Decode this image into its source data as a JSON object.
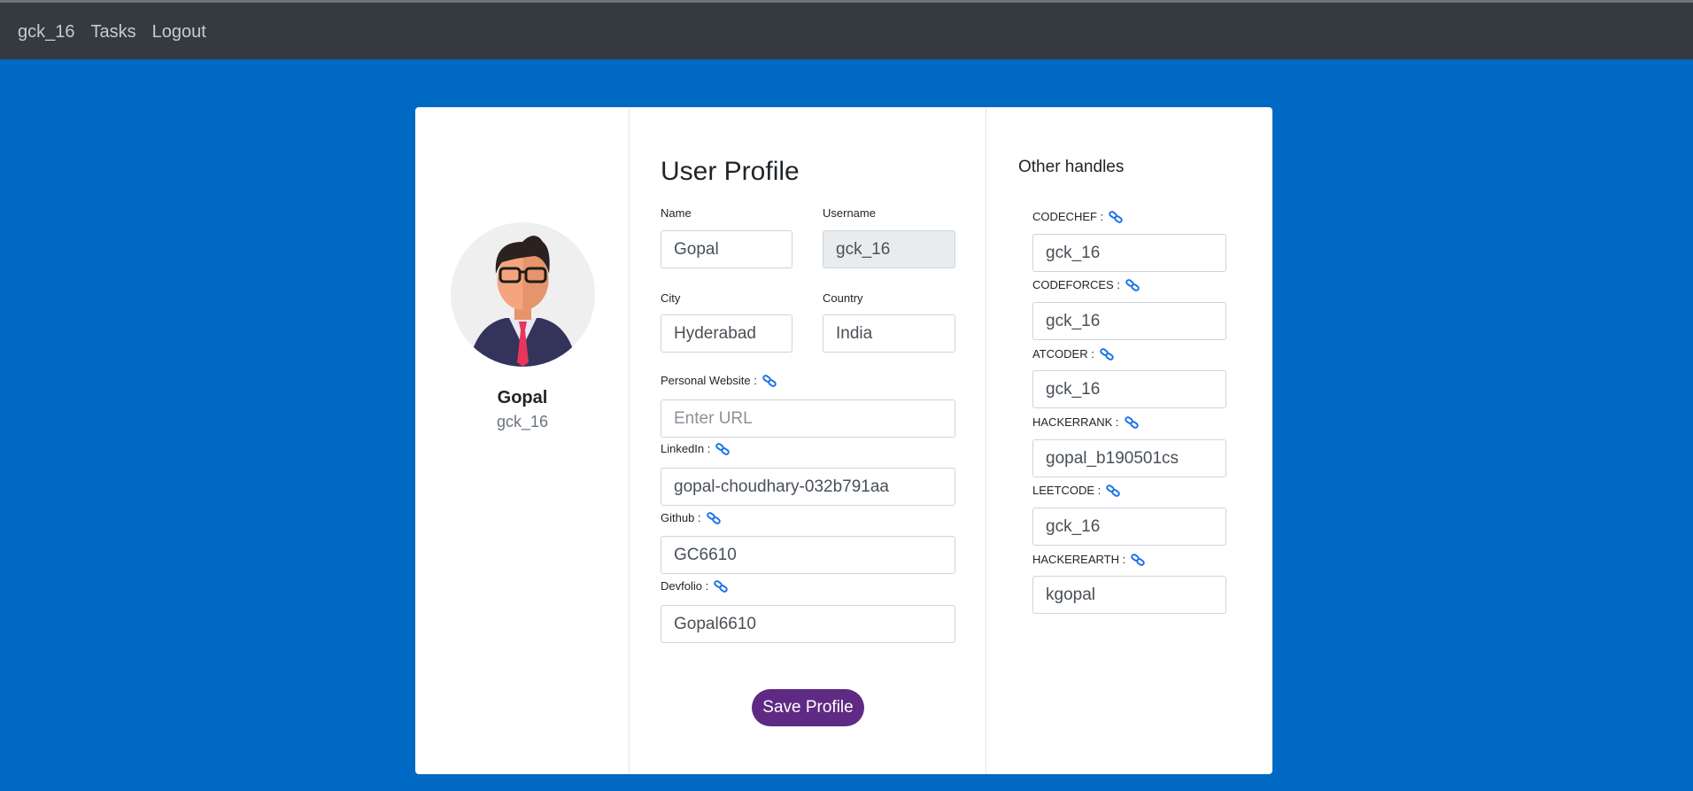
{
  "nav": {
    "brand": "gck_16",
    "tasks": "Tasks",
    "logout": "Logout"
  },
  "profile": {
    "display_name": "Gopal",
    "display_username": "gck_16"
  },
  "form": {
    "title": "User Profile",
    "name_label": "Name",
    "name_value": "Gopal",
    "username_label": "Username",
    "username_value": "gck_16",
    "city_label": "City",
    "city_value": "Hyderabad",
    "country_label": "Country",
    "country_value": "India",
    "website_label": "Personal Website :",
    "website_value": "",
    "website_placeholder": "Enter URL",
    "linkedin_label": "LinkedIn :",
    "linkedin_value": "gopal-choudhary-032b791aa",
    "github_label": "Github :",
    "github_value": "GC6610",
    "devfolio_label": "Devfolio :",
    "devfolio_value": "Gopal6610",
    "save_label": "Save Profile"
  },
  "handles": {
    "title": "Other handles",
    "items": [
      {
        "label": "CODECHEF :",
        "value": "gck_16"
      },
      {
        "label": "CODEFORCES :",
        "value": "gck_16"
      },
      {
        "label": "ATCODER :",
        "value": "gck_16"
      },
      {
        "label": "HACKERRANK :",
        "value": "gopal_b190501cs"
      },
      {
        "label": "LEETCODE :",
        "value": "gck_16"
      },
      {
        "label": "HACKEREARTH :",
        "value": "kgopal"
      }
    ]
  },
  "colors": {
    "page_bg": "#0069c4",
    "navbar": "#343a40",
    "save_button": "#5f2a83",
    "link_icon": "#1a73e8"
  },
  "icons": {
    "link": "link-icon"
  }
}
